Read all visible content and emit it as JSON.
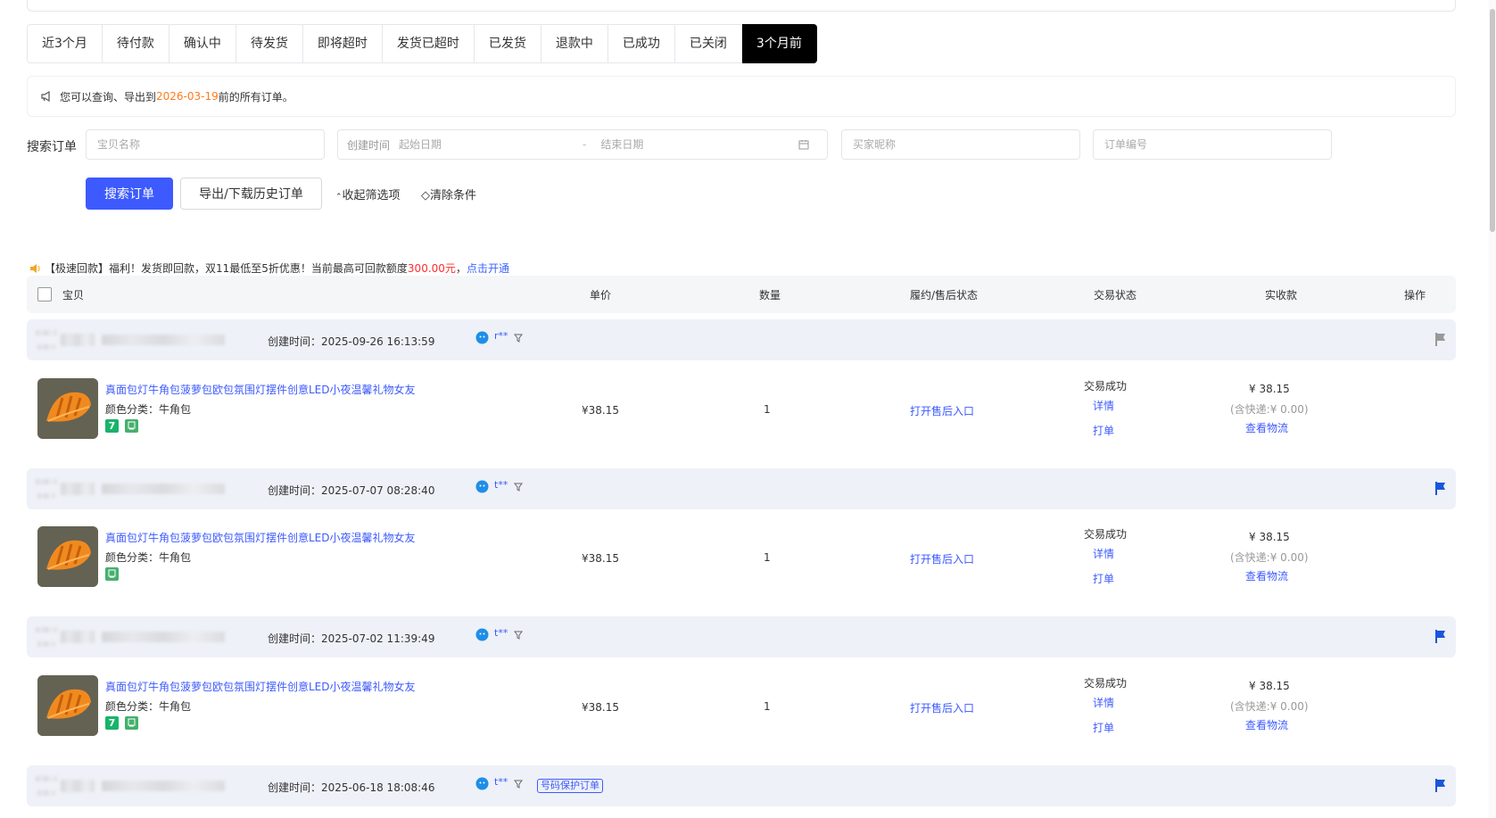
{
  "tabs": [
    "近3个月",
    "待付款",
    "确认中",
    "待发货",
    "即将超时",
    "发货已超时",
    "已发货",
    "退款中",
    "已成功",
    "已关闭",
    "3个月前"
  ],
  "active_tab": "3个月前",
  "notice": {
    "prefix": "您可以查询、导出到 ",
    "date": "2026-03-19",
    "suffix": " 前的所有订单。"
  },
  "search": {
    "label": "搜索订单",
    "item_placeholder": "宝贝名称",
    "created_label": "创建时间",
    "start_placeholder": "起始日期",
    "date_sep": "-",
    "end_placeholder": "结束日期",
    "buyer_placeholder": "买家昵称",
    "order_placeholder": "订单编号",
    "search_button": "搜索订单",
    "export_button": "导出/下载历史订单",
    "collapse_link": "收起筛选项",
    "clear_link": "清除条件"
  },
  "promo": {
    "a": "【极速回款】福利！发货即回款，双11最低至5折优惠！当前最高可回款额度",
    "amount": "300.00元",
    "b": "，",
    "link": "点击开通"
  },
  "columns": {
    "item": "宝贝",
    "price": "单价",
    "qty": "数量",
    "after": "履约/售后状态",
    "trade": "交易状态",
    "paid": "实收款",
    "op": "操作"
  },
  "orders": [
    {
      "created": "创建时间：2025-09-26 16:13:59",
      "buyer": "r**",
      "badge": "",
      "title": "真面包灯牛角包菠萝包欧包氛围灯摆件创意LED小夜温馨礼物女友",
      "sku": "颜色分类：牛角包",
      "tag7": true,
      "price": "¥38.15",
      "qty": "1",
      "after": "打开售后入口",
      "status": "交易成功",
      "detail": "详情",
      "print": "打单",
      "amount": "¥ 38.15",
      "shipping": "(含快递:¥ 0.00)",
      "logistics": "查看物流",
      "flag_color": "#999999"
    },
    {
      "created": "创建时间：2025-07-07 08:28:40",
      "buyer": "t**",
      "badge": "",
      "title": "真面包灯牛角包菠萝包欧包氛围灯摆件创意LED小夜温馨礼物女友",
      "sku": "颜色分类：牛角包",
      "tag7": false,
      "price": "¥38.15",
      "qty": "1",
      "after": "打开售后入口",
      "status": "交易成功",
      "detail": "详情",
      "print": "打单",
      "amount": "¥ 38.15",
      "shipping": "(含快递:¥ 0.00)",
      "logistics": "查看物流",
      "flag_color": "#1a56db"
    },
    {
      "created": "创建时间：2025-07-02 11:39:49",
      "buyer": "t**",
      "badge": "",
      "title": "真面包灯牛角包菠萝包欧包氛围灯摆件创意LED小夜温馨礼物女友",
      "sku": "颜色分类：牛角包",
      "tag7": true,
      "price": "¥38.15",
      "qty": "1",
      "after": "打开售后入口",
      "status": "交易成功",
      "detail": "详情",
      "print": "打单",
      "amount": "¥ 38.15",
      "shipping": "(含快递:¥ 0.00)",
      "logistics": "查看物流",
      "flag_color": "#1a56db"
    },
    {
      "created": "创建时间：2025-06-18 18:08:46",
      "buyer": "t**",
      "badge": "号码保护订单",
      "flag_color": "#1a56db"
    }
  ]
}
